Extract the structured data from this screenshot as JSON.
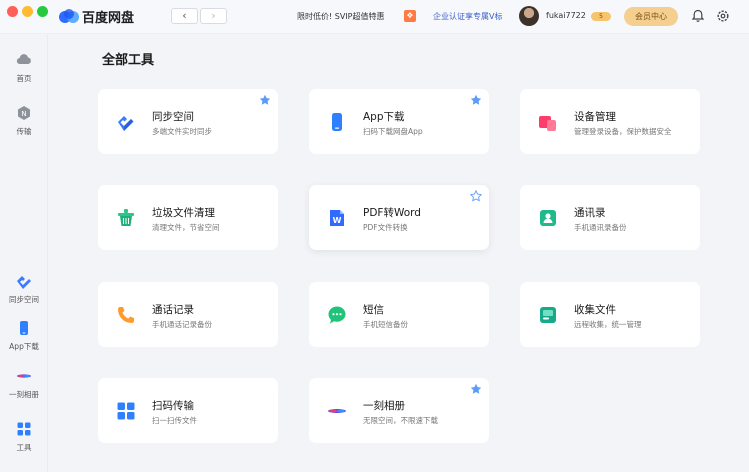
{
  "app": {
    "name": "百度网盘"
  },
  "titlebar": {
    "back_icon": "‹",
    "forward_icon": "›",
    "promo": "限时低价! SVIP超值特惠",
    "enterprise": "企业认证享专属V标",
    "username": "fukai7722",
    "vip_badge": "5",
    "member_button": "会员中心"
  },
  "sidebar": {
    "items": [
      {
        "label": "首页",
        "icon": "cloud-home-icon"
      },
      {
        "label": "传输",
        "icon": "transfer-icon"
      },
      {
        "label": "同步空间",
        "icon": "sync-icon"
      },
      {
        "label": "App下载",
        "icon": "phone-icon"
      },
      {
        "label": "一刻相册",
        "icon": "album-icon"
      },
      {
        "label": "工具",
        "icon": "tools-grid-icon"
      }
    ]
  },
  "main": {
    "title": "全部工具",
    "tools": [
      {
        "title": "同步空间",
        "desc": "多端文件实时同步",
        "starred": true
      },
      {
        "title": "App下载",
        "desc": "扫码下载网盘App",
        "starred": true
      },
      {
        "title": "设备管理",
        "desc": "管理登录设备，保护数据安全",
        "starred": false
      },
      {
        "title": "垃圾文件清理",
        "desc": "清理文件，节省空间",
        "starred": false
      },
      {
        "title": "PDF转Word",
        "desc": "PDF文件转换",
        "starred": false
      },
      {
        "title": "通讯录",
        "desc": "手机通讯录备份",
        "starred": false
      },
      {
        "title": "通话记录",
        "desc": "手机通话记录备份",
        "starred": false
      },
      {
        "title": "短信",
        "desc": "手机短信备份",
        "starred": false
      },
      {
        "title": "收集文件",
        "desc": "远程收集，统一管理",
        "starred": false
      },
      {
        "title": "扫码传输",
        "desc": "扫一扫传文件",
        "starred": false
      },
      {
        "title": "一刻相册",
        "desc": "无限空间，不限速下载",
        "starred": true
      }
    ]
  },
  "colors": {
    "accent": "#3a7bff",
    "star": "#5b9cf8",
    "member": "#f5cf8f"
  }
}
